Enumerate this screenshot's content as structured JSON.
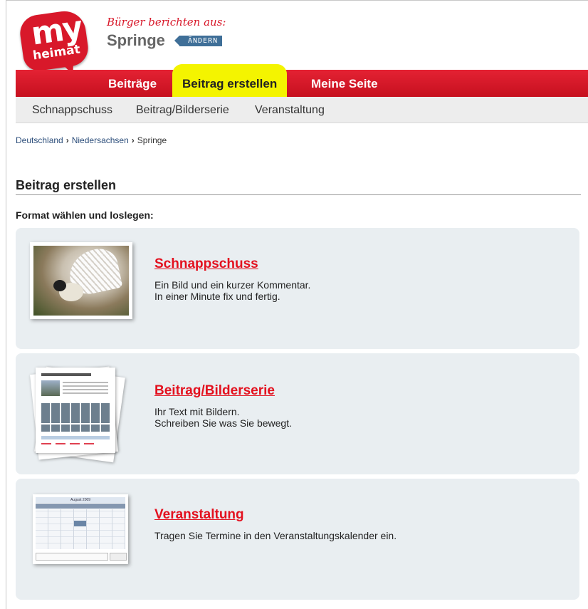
{
  "header": {
    "logo": {
      "my": "my",
      "heimat": "heimat"
    },
    "tagline": "Bürger berichten aus:",
    "city": "Springe",
    "change_label": "ÄNDERN"
  },
  "nav": {
    "items": [
      {
        "label": "Beiträge"
      },
      {
        "label": "Beitrag erstellen",
        "active": true
      },
      {
        "label": "Meine Seite"
      }
    ],
    "highlight_color": "#f4f400",
    "bar_color": "#d8182a"
  },
  "subnav": {
    "items": [
      {
        "label": "Schnappschuss"
      },
      {
        "label": "Beitrag/Bilderserie"
      },
      {
        "label": "Veranstaltung"
      }
    ]
  },
  "breadcrumb": {
    "items": [
      "Deutschland",
      "Niedersachsen",
      "Springe"
    ],
    "separator": "›"
  },
  "main": {
    "title": "Beitrag erstellen",
    "intro": "Format wählen und loslegen:",
    "cards": [
      {
        "title": "Schnappschuss",
        "desc_line1": "Ein Bild und ein kurzer Kommentar.",
        "desc_line2": "In einer Minute fix und fertig.",
        "thumb": "bird-photo"
      },
      {
        "title": "Beitrag/Bilderserie",
        "desc_line1": "Ihr Text mit Bildern.",
        "desc_line2": "Schreiben Sie was Sie bewegt.",
        "thumb": "document-pages"
      },
      {
        "title": "Veranstaltung",
        "desc_line1": "Tragen Sie Termine in den Veranstaltungskalender ein.",
        "thumb": "calendar",
        "calendar_month": "August 2009"
      }
    ]
  }
}
